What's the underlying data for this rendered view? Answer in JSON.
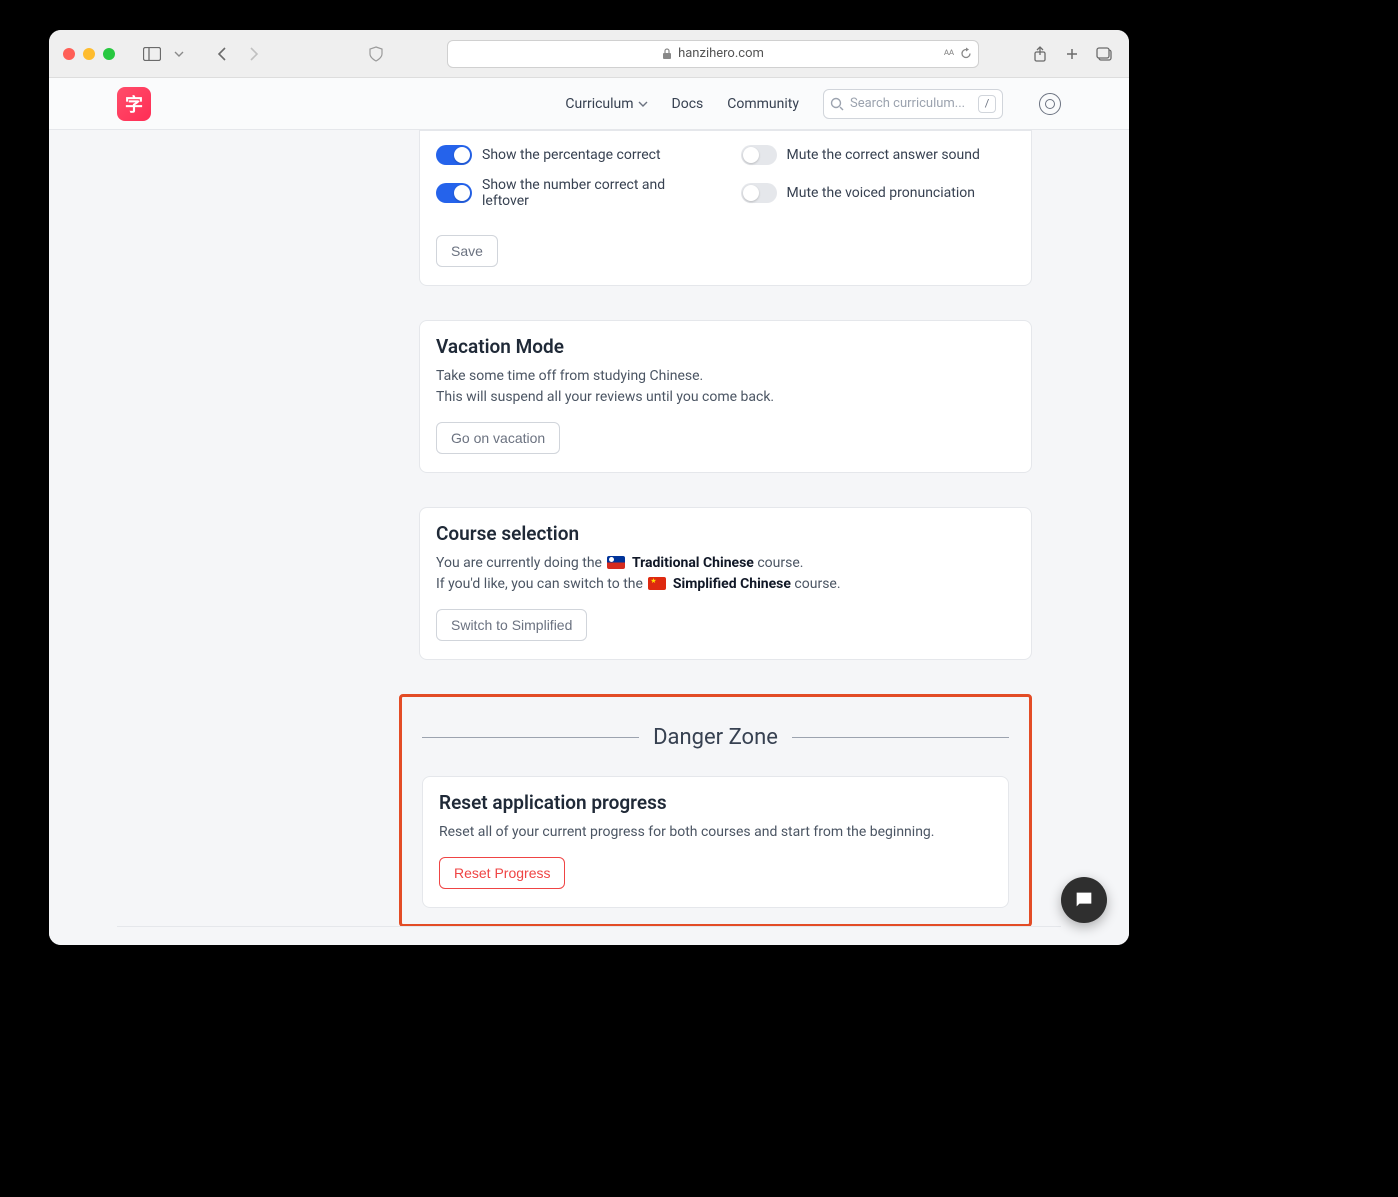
{
  "browser": {
    "domain": "hanzihero.com"
  },
  "header": {
    "nav": {
      "curriculum": "Curriculum",
      "docs": "Docs",
      "community": "Community"
    },
    "search_placeholder": "Search curriculum...",
    "search_shortcut": "/"
  },
  "toggles": {
    "percentage": "Show the percentage correct",
    "number_correct": "Show the number correct and leftover",
    "mute_correct": "Mute the correct answer sound",
    "mute_voice": "Mute the voiced pronunciation",
    "save_label": "Save"
  },
  "vacation": {
    "title": "Vacation Mode",
    "desc1": "Take some time off from studying Chinese.",
    "desc2": "This will suspend all your reviews until you come back.",
    "button": "Go on vacation"
  },
  "course": {
    "title": "Course selection",
    "line1_a": "You are currently doing the ",
    "line1_b": "Traditional Chinese",
    "line1_c": " course.",
    "line2_a": "If you'd like, you can switch to the ",
    "line2_b": "Simplified Chinese",
    "line2_c": " course.",
    "button": "Switch to Simplified"
  },
  "danger": {
    "heading": "Danger Zone",
    "reset_title": "Reset application progress",
    "reset_desc": "Reset all of your current progress for both courses and start from the beginning.",
    "reset_button": "Reset Progress"
  }
}
